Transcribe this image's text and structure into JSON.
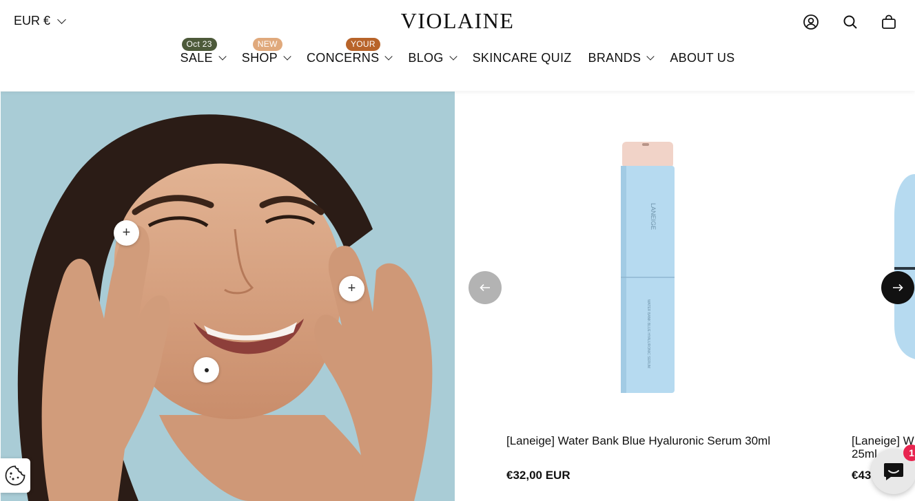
{
  "header": {
    "currency": "EUR €",
    "logo": "VIOLAINE",
    "nav": [
      {
        "label": "SALE",
        "badge": "Oct 23",
        "badge_color": "#4d5a3a",
        "dropdown": true
      },
      {
        "label": "SHOP",
        "badge": "NEW",
        "badge_color": "#e0a97c",
        "dropdown": true
      },
      {
        "label": "CONCERNS",
        "badge": "YOUR",
        "badge_color": "#b8642a",
        "dropdown": true
      },
      {
        "label": "BLOG",
        "dropdown": true
      },
      {
        "label": "SKINCARE QUIZ",
        "dropdown": false
      },
      {
        "label": "BRANDS",
        "dropdown": true
      },
      {
        "label": "ABOUT US",
        "dropdown": false
      }
    ],
    "icons": [
      "account-icon",
      "search-icon",
      "cart-icon"
    ]
  },
  "hero": {
    "hotspots": [
      "plus-icon",
      "plus-icon",
      "dot-icon"
    ]
  },
  "products": [
    {
      "title": "[Laneige] Water Bank Blue Hyaluronic Serum 30ml",
      "price": "€32,00 EUR",
      "bottle_brand": "LANEIGE",
      "bottle_line": "WATER BANK BLUE HYALURONIC SERUM"
    },
    {
      "title_line1": "[Laneige] W",
      "title_line2": "25ml",
      "price": "€43"
    }
  ],
  "carousel": {
    "prev_icon": "arrow-left-icon",
    "next_icon": "arrow-right-icon"
  },
  "chat": {
    "unread": "1"
  },
  "colors": {
    "hero_bg": "#a9ccd6",
    "bottle_blue": "#b6daf0",
    "bottle_cap": "#f1d3c8",
    "arrow_prev_bg": "#b3b3b3",
    "arrow_next_bg": "#111111",
    "chat_badge": "#e8244f"
  }
}
